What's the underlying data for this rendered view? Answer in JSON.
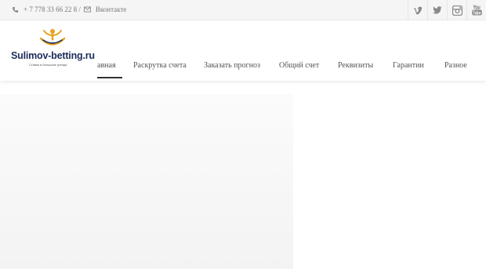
{
  "topbar": {
    "phone": "+ 7 778 33 66 22 8 /",
    "phone_icon": "phone-icon",
    "social_link": "Вконтакте",
    "mail_icon": "mail-icon",
    "socials": [
      {
        "icon": "vimeo-icon"
      },
      {
        "icon": "twitter-icon"
      },
      {
        "icon": "instagram-icon"
      },
      {
        "icon": "youtube-icon"
      }
    ]
  },
  "logo": {
    "name": "Sulimov-betting.ru",
    "tagline": "Ставки в большом тренде",
    "accent_color": "#e6a21e",
    "brand_color": "#1c2e5b"
  },
  "nav": {
    "items": [
      {
        "label": "авная",
        "active": true
      },
      {
        "label": "Раскрутка счета"
      },
      {
        "label": "Заказать прогноз"
      },
      {
        "label": "Общий счет"
      },
      {
        "label": "Реквизиты"
      },
      {
        "label": "Гарантии"
      },
      {
        "label": "Разное"
      }
    ]
  }
}
